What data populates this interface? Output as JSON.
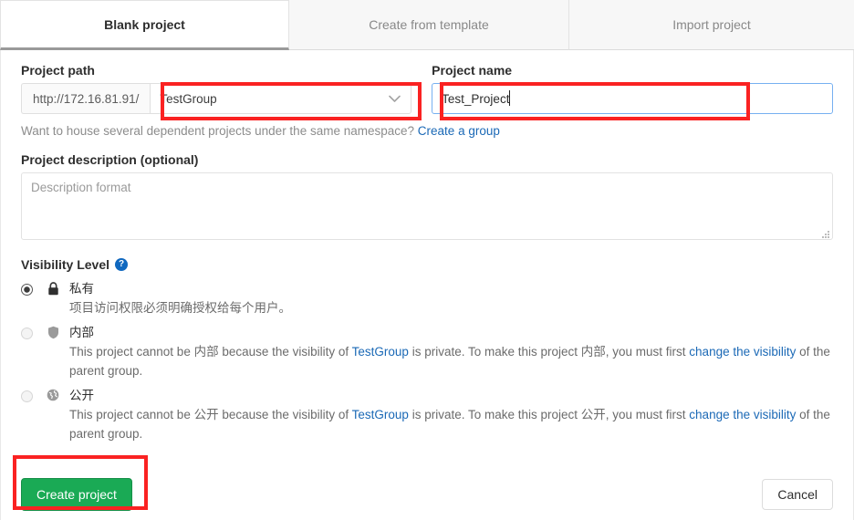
{
  "tabs": [
    {
      "label": "Blank project",
      "active": true
    },
    {
      "label": "Create from template",
      "active": false
    },
    {
      "label": "Import project",
      "active": false
    }
  ],
  "project_path": {
    "label": "Project path",
    "url_prefix": "http://172.16.81.91/",
    "selected_namespace": "TestGroup",
    "chevron_icon": "chevron-down-icon"
  },
  "project_name": {
    "label": "Project name",
    "value": "Test_Project"
  },
  "namespace_hint": {
    "text": "Want to house several dependent projects under the same namespace?",
    "link_label": "Create a group"
  },
  "description": {
    "label": "Project description (optional)",
    "placeholder": "Description format",
    "value": ""
  },
  "visibility": {
    "label": "Visibility Level",
    "help_icon": "question-mark-icon",
    "options": [
      {
        "icon": "lock-icon",
        "title": "私有",
        "selected": true,
        "disabled": false,
        "description_plain": "项目访问权限必须明确授权给每个用户。",
        "desc_parts": []
      },
      {
        "icon": "shield-icon",
        "title": "内部",
        "selected": false,
        "disabled": true,
        "description_plain": "",
        "desc_parts": [
          {
            "t": "This project cannot be 内部 because the visibility of ",
            "link": false
          },
          {
            "t": "TestGroup",
            "link": true
          },
          {
            "t": " is private. To make this project 内部, you must first ",
            "link": false
          },
          {
            "t": "change the visibility",
            "link": true
          },
          {
            "t": " of the parent group.",
            "link": false
          }
        ]
      },
      {
        "icon": "globe-icon",
        "title": "公开",
        "selected": false,
        "disabled": true,
        "description_plain": "",
        "desc_parts": [
          {
            "t": "This project cannot be 公开 because the visibility of ",
            "link": false
          },
          {
            "t": "TestGroup",
            "link": true
          },
          {
            "t": " is private. To make this project 公开, you must first ",
            "link": false
          },
          {
            "t": "change the visibility",
            "link": true
          },
          {
            "t": " of the parent group.",
            "link": false
          }
        ]
      }
    ]
  },
  "footer": {
    "create_label": "Create project",
    "cancel_label": "Cancel"
  },
  "colors": {
    "accent_green": "#1aaa55",
    "link_blue": "#1b69b6",
    "focus_blue": "#76b0f1",
    "annotation_red": "#fa2222",
    "help_badge_blue": "#1068bf"
  }
}
